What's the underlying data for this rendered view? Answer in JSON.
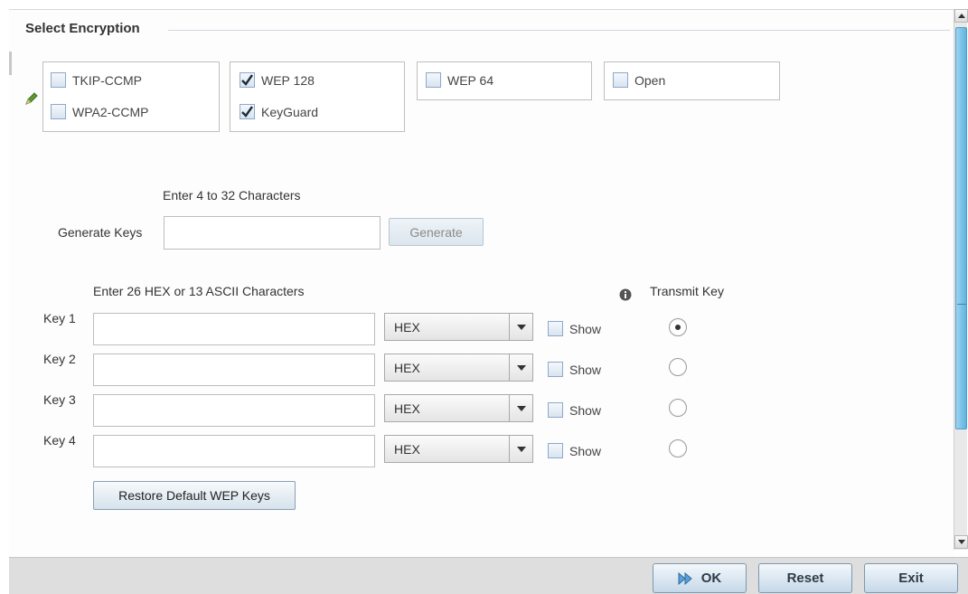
{
  "section": {
    "title": "Select Encryption"
  },
  "encryption_options": {
    "tkip_ccmp": {
      "label": "TKIP-CCMP",
      "checked": false
    },
    "wpa2_ccmp": {
      "label": "WPA2-CCMP",
      "checked": false
    },
    "wep128": {
      "label": "WEP 128",
      "checked": true
    },
    "keyguard": {
      "label": "KeyGuard",
      "checked": true
    },
    "wep64": {
      "label": "WEP 64",
      "checked": false
    },
    "open": {
      "label": "Open",
      "checked": false
    }
  },
  "generate": {
    "hint": "Enter 4 to 32 Characters",
    "label": "Generate Keys",
    "value": "",
    "button_label": "Generate"
  },
  "keys": {
    "hint": "Enter 26 HEX or 13 ASCII Characters",
    "transmit_key_label": "Transmit Key",
    "transmit_selected": 1,
    "rows": [
      {
        "label": "Key 1",
        "value": "",
        "format": "HEX",
        "show_label": "Show",
        "show": false
      },
      {
        "label": "Key 2",
        "value": "",
        "format": "HEX",
        "show_label": "Show",
        "show": false
      },
      {
        "label": "Key 3",
        "value": "",
        "format": "HEX",
        "show_label": "Show",
        "show": false
      },
      {
        "label": "Key 4",
        "value": "",
        "format": "HEX",
        "show_label": "Show",
        "show": false
      }
    ],
    "restore_button_label": "Restore Default WEP Keys"
  },
  "footer": {
    "ok_label": "OK",
    "reset_label": "Reset",
    "exit_label": "Exit"
  },
  "icons": {
    "edit": "pencil-icon",
    "info": "info-icon",
    "ok": "play-icon"
  },
  "colors": {
    "accent": "#5fb4e0",
    "checkbox_border": "#8fa8c8",
    "pencil": "#4f8f2a"
  }
}
